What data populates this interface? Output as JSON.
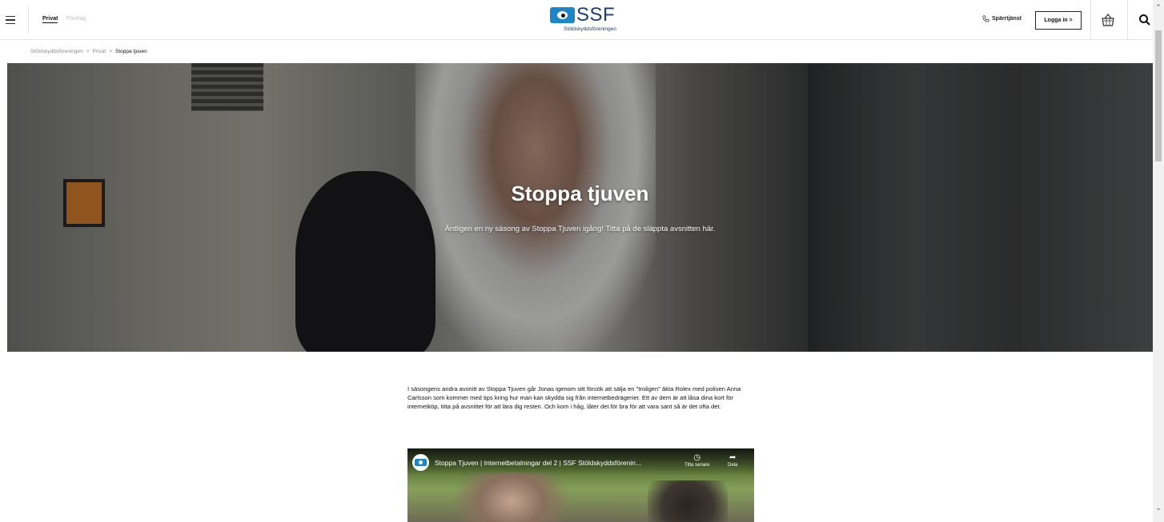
{
  "header": {
    "segments": {
      "privat": "Privat",
      "foretag": "Företag"
    },
    "logo": {
      "text": "SSF",
      "subtitle": "Stöldskyddsföreningen"
    },
    "sparrtjanst_label": "Spärrtjänst",
    "login_label": "Logga in >"
  },
  "breadcrumb": {
    "items": [
      "Stöldskyddsföreningen",
      ">",
      "Privat",
      ">",
      "Stoppa tjuven"
    ]
  },
  "hero": {
    "title": "Stoppa tjuven",
    "subtitle": "Äntligen en ny säsong av Stoppa Tjuven igång! Titta på de släppta avsnitten här."
  },
  "article": {
    "body": "I säsongens andra avsnitt av Stoppa Tjuven går Jonas igenom sitt försök att sälja en \"troligen\" äkta Rolex med polisen Anna Carlsson som kommer med tips kring hur man kan skydda sig från internetbedrägerier. Ett av dem är att låsa dina kort för internetköp, titta på avsnittet för att lära dig resten. Och kom i håg, låter det för bra för att vara sant så är det ofta det."
  },
  "video": {
    "title": "Stoppa Tjuven | Internetbetalningar del 2 | SSF Stöldskyddsförenin...",
    "watch_later": "Titta senare",
    "share": "Dela"
  },
  "colors": {
    "brand_blue": "#1c86c8",
    "brand_navy": "#1b3f6b"
  },
  "icons": [
    "hamburger-icon",
    "phone-icon",
    "basket-icon",
    "search-icon",
    "clock-icon",
    "share-icon"
  ]
}
